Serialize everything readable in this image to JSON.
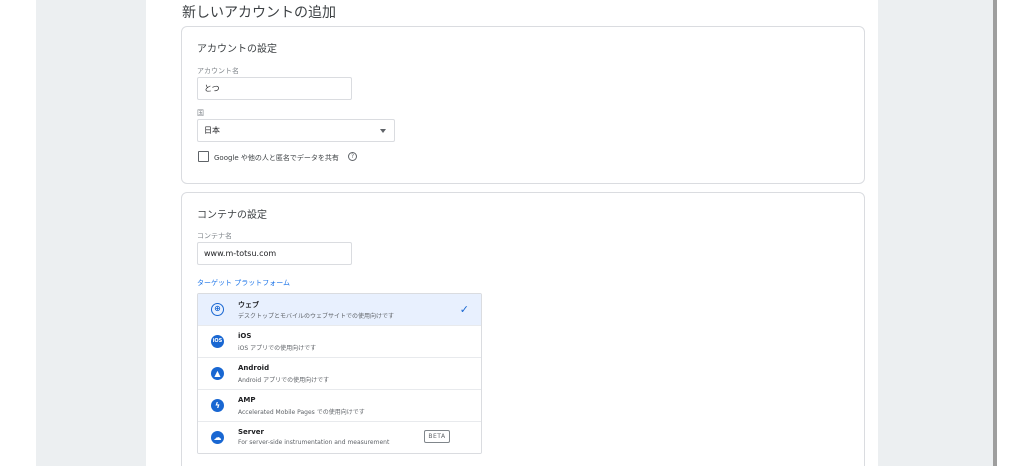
{
  "page": {
    "title": "新しいアカウントの追加"
  },
  "account_settings": {
    "title": "アカウントの設定",
    "account_name_label": "アカウント名",
    "account_name_value": "とつ",
    "country_label": "国",
    "country_value": "日本",
    "share_checkbox_label": "Google や他の人と匿名でデータを共有",
    "share_checked": false,
    "help_icon": "help-circle-icon"
  },
  "container_settings": {
    "title": "コンテナの設定",
    "container_name_label": "コンテナ名",
    "container_name_value": "www.m-totsu.com",
    "platform_heading": "ターゲット プラットフォーム",
    "platforms": [
      {
        "name": "ウェブ",
        "description": "デスクトップとモバイルのウェブサイトでの使用向けです",
        "icon": "globe-icon",
        "selected": true
      },
      {
        "name": "iOS",
        "description": "iOS アプリでの使用向けです",
        "icon": "ios-icon",
        "selected": false
      },
      {
        "name": "Android",
        "description": "Android アプリでの使用向けです",
        "icon": "android-icon",
        "selected": false
      },
      {
        "name": "AMP",
        "description": "Accelerated Mobile Pages での使用向けです",
        "icon": "amp-bolt-icon",
        "selected": false
      },
      {
        "name": "Server",
        "description": "For server-side instrumentation and measurement",
        "icon": "cloud-icon",
        "selected": false,
        "badge": "BETA"
      }
    ]
  },
  "colors": {
    "accent": "#1967d2",
    "link": "#1a73e8",
    "selected_bg": "#e8f0fe",
    "page_bg": "#eceff1"
  }
}
